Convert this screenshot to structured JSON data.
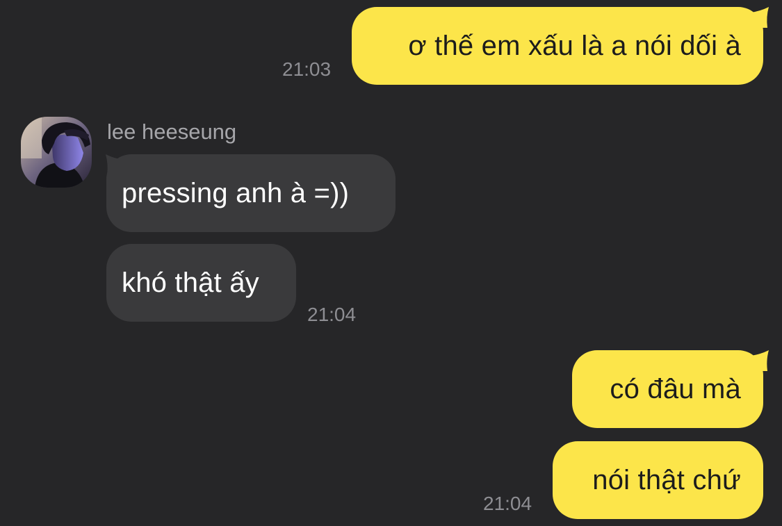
{
  "messages": [
    {
      "from": "me",
      "text": "ơ thế em xấu là a nói dối à",
      "time": "21:03"
    },
    {
      "from": "them",
      "sender": "lee heeseung",
      "text": "pressing anh à =))"
    },
    {
      "from": "them",
      "text": "khó thật ấy",
      "time": "21:04"
    },
    {
      "from": "me",
      "text": "có đâu mà"
    },
    {
      "from": "me",
      "text": "nói thật chứ",
      "time": "21:04"
    }
  ],
  "colors": {
    "background": "#262628",
    "my_bubble": "#fce54a",
    "their_bubble": "#3a3a3c",
    "timestamp": "#8e8e93",
    "sender_name": "#a6a6aa"
  },
  "icons": {
    "avatar": "profile-photo"
  }
}
